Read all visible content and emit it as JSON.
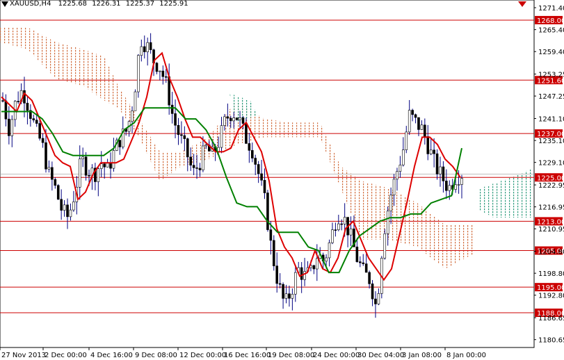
{
  "header": {
    "symbol": "XAUUSD,H4",
    "open": "1225.68",
    "high": "1226.31",
    "low": "1225.37",
    "close": "1225.91"
  },
  "colors": {
    "background": "#ffffff",
    "level_line": "#cc0000",
    "candles": "#000080",
    "tenkan": "#dd0000",
    "kijun": "#008000",
    "cloud_bear": "#d06a3a",
    "cloud_bull": "#2a9a7a"
  },
  "chart_data": {
    "type": "candlestick",
    "title": "XAUUSD,H4",
    "ylim": [
      1178.5,
      1273.5
    ],
    "y_ticks": [
      "1271.40",
      "1265.40",
      "1259.40",
      "1253.25",
      "1247.25",
      "1241.10",
      "1235.10",
      "1229.10",
      "1222.95",
      "1216.95",
      "1210.95",
      "1204.80",
      "1198.80",
      "1192.80",
      "1186.65",
      "1180.65"
    ],
    "x_ticks": [
      "27 Nov 2013",
      "2 Dec 00:00",
      "4 Dec 16:00",
      "9 Dec 08:00",
      "12 Dec 00:00",
      "16 Dec 16:00",
      "19 Dec 08:00",
      "24 Dec 00:00",
      "30 Dec 04:00",
      "3 Jan 08:00",
      "8 Jan 00:00"
    ],
    "levels": [
      1268.0,
      1251.6,
      1237.0,
      1225.0,
      1213.0,
      1205.0,
      1195.0,
      1188.0
    ],
    "level_labels": [
      "1268.00",
      "1251.60",
      "1237.00",
      "1225.00",
      "1213.00",
      "1205.00",
      "1195.00",
      "1188.00"
    ],
    "current_price_label": "1225.91",
    "price_path": [
      1246,
      1238,
      1246,
      1249,
      1244,
      1238,
      1234,
      1226,
      1222,
      1216,
      1214,
      1221,
      1230,
      1227,
      1226,
      1229,
      1227,
      1232,
      1236,
      1238,
      1247,
      1263,
      1261,
      1257,
      1255,
      1250,
      1241,
      1236,
      1232,
      1226,
      1229,
      1233,
      1231,
      1235,
      1241,
      1243,
      1241,
      1236,
      1233,
      1226,
      1218,
      1205,
      1196,
      1190,
      1194,
      1200,
      1198,
      1199,
      1204,
      1202,
      1208,
      1215,
      1214,
      1209,
      1203,
      1199,
      1197,
      1189,
      1209,
      1219,
      1226,
      1232,
      1242,
      1240,
      1238,
      1233,
      1228,
      1225,
      1222,
      1225,
      1226
    ],
    "tenkan": [
      1247,
      1245,
      1243,
      1248,
      1246,
      1241,
      1236,
      1231,
      1229,
      1228,
      1219,
      1221,
      1226,
      1229,
      1229,
      1229,
      1230,
      1235,
      1240,
      1247,
      1257,
      1259,
      1252,
      1247,
      1241,
      1236,
      1236,
      1234,
      1232,
      1232,
      1233,
      1238,
      1240,
      1236,
      1232,
      1224,
      1211,
      1206,
      1203,
      1198,
      1199,
      1205,
      1200,
      1199,
      1203,
      1211,
      1213,
      1208,
      1203,
      1200,
      1197,
      1200,
      1209,
      1218,
      1228,
      1236,
      1236,
      1234,
      1230,
      1228,
      1225
    ],
    "kijun": [
      1243,
      1243,
      1243,
      1243,
      1241,
      1237,
      1232,
      1231,
      1231,
      1231,
      1231,
      1233,
      1238,
      1240,
      1244,
      1244,
      1244,
      1244,
      1241,
      1241,
      1238,
      1233,
      1225,
      1218,
      1217,
      1217,
      1213,
      1210,
      1210,
      1210,
      1206,
      1205,
      1199,
      1199,
      1205,
      1209,
      1211,
      1213,
      1214,
      1214,
      1215,
      1215,
      1218,
      1219,
      1220,
      1233
    ],
    "legend": []
  }
}
